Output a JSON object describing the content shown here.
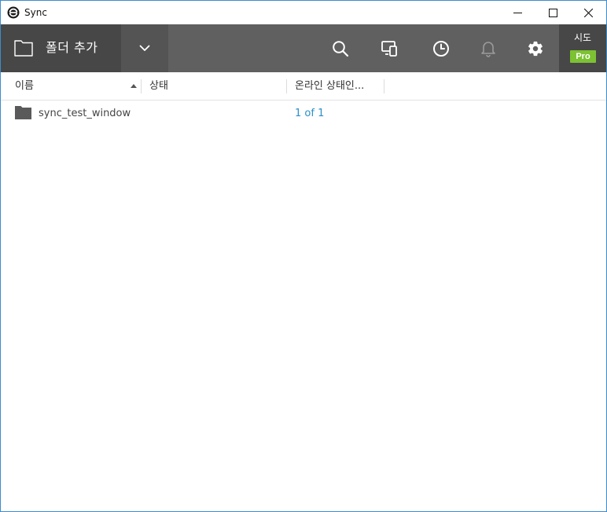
{
  "window": {
    "title": "Sync"
  },
  "toolbar": {
    "add_folder_label": "폴더 추가",
    "trial_label": "시도",
    "pro_label": "Pro",
    "icons": [
      "folder-icon",
      "chevron-down-icon",
      "search-icon",
      "devices-icon",
      "history-icon",
      "bell-icon",
      "gear-icon"
    ]
  },
  "columns": {
    "name": "이름",
    "status": "상태",
    "online": "온라인 상태인..."
  },
  "rows": [
    {
      "name": "sync_test_window",
      "status": "",
      "online": "1 of 1"
    }
  ],
  "colors": {
    "toolbar_bg": "#606060",
    "toolbar_dark": "#474747",
    "pro_badge": "#7cc232",
    "link_blue": "#2a8fc7",
    "window_border": "#3c8ccc"
  }
}
